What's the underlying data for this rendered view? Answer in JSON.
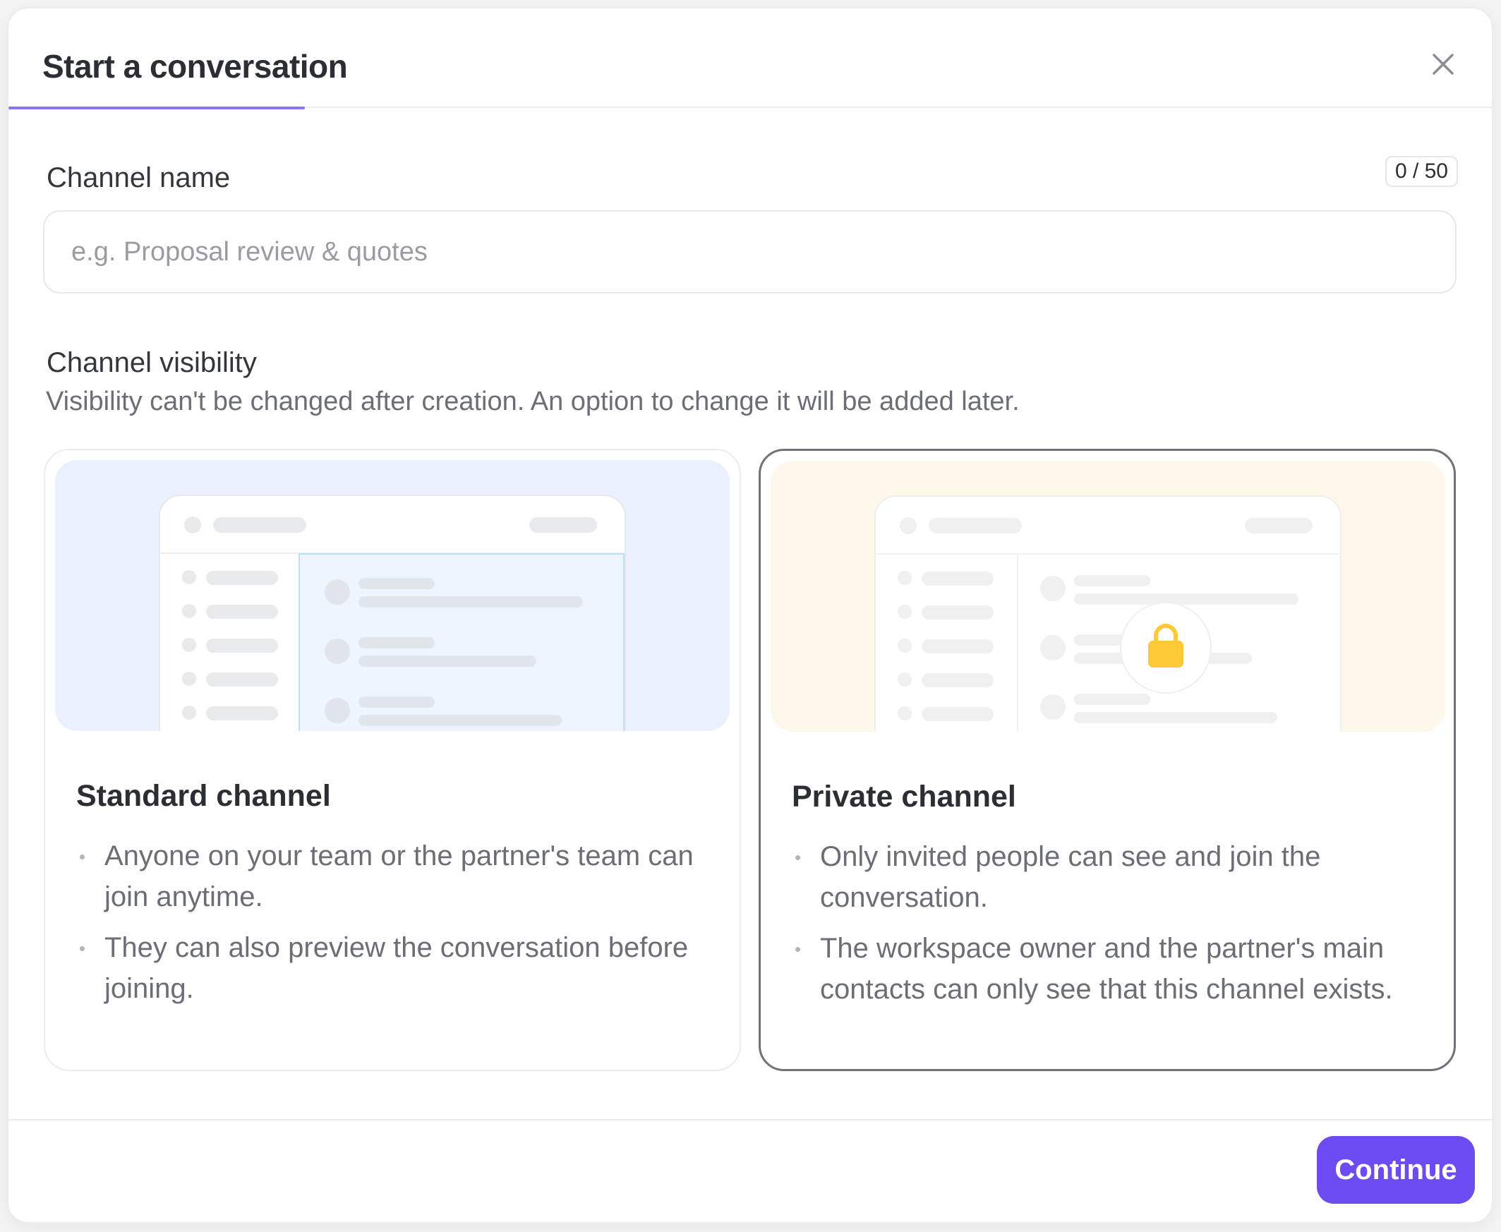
{
  "dialog": {
    "title": "Start a conversation",
    "progress_fraction": 0.2
  },
  "channel_name": {
    "label": "Channel name",
    "counter": "0 / 50",
    "placeholder": "e.g. Proposal review & quotes",
    "value": ""
  },
  "visibility": {
    "label": "Channel visibility",
    "hint": "Visibility can't be changed after creation. An option to change it will be added later.",
    "selected": "private",
    "options": [
      {
        "id": "standard",
        "title": "Standard channel",
        "bullets": [
          "Anyone on your team or the partner's team can join anytime.",
          "They can also preview the conversation before joining."
        ],
        "illustration_bg": "#eaf1fd"
      },
      {
        "id": "private",
        "title": "Private channel",
        "bullets": [
          "Only invited people can see and join the conversation.",
          "The workspace owner and the partner's main contacts can only see that this channel exists."
        ],
        "illustration_bg": "#fef8eb",
        "icon": "lock-icon"
      }
    ]
  },
  "footer": {
    "continue_label": "Continue"
  },
  "colors": {
    "accent": "#6c4cf1",
    "progress": "#8b78f0",
    "lock": "#fdc936"
  }
}
